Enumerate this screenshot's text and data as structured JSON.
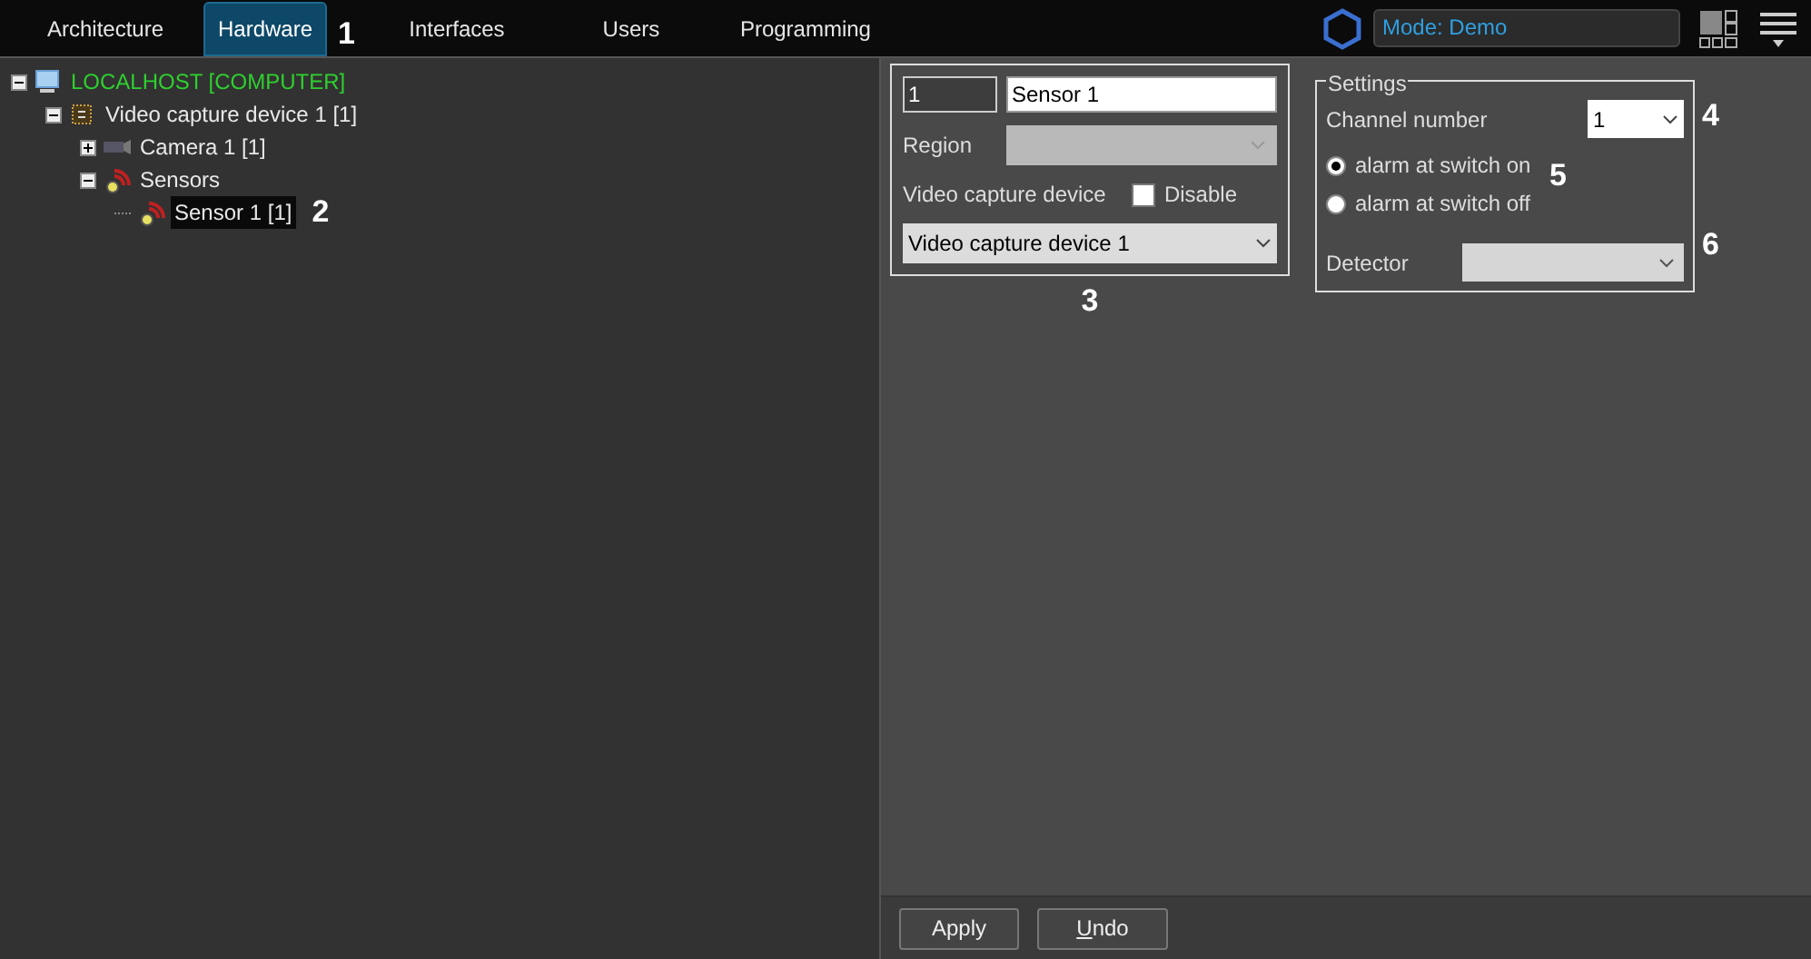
{
  "tabs": [
    {
      "label": "Architecture",
      "selected": false
    },
    {
      "label": "Hardware",
      "selected": true,
      "callout": "1"
    },
    {
      "label": "Interfaces",
      "selected": false
    },
    {
      "label": "Users",
      "selected": false
    },
    {
      "label": "Programming",
      "selected": false
    }
  ],
  "mode": {
    "value": "Mode: Demo"
  },
  "tree": [
    {
      "label": "LOCALHOST [COMPUTER]",
      "kind": "computer",
      "expanded": true,
      "selected": false,
      "children": [
        {
          "label": "Video capture device 1 [1]",
          "kind": "board",
          "expanded": true,
          "selected": false,
          "children": [
            {
              "label": "Camera 1 [1]",
              "kind": "camera",
              "expanded": false,
              "selected": false
            },
            {
              "label": "Sensors",
              "kind": "sensor",
              "expanded": true,
              "selected": false,
              "children": [
                {
                  "label": "Sensor 1 [1]",
                  "kind": "sensor",
                  "selected": true,
                  "callout": "2"
                }
              ]
            }
          ]
        }
      ]
    }
  ],
  "object": {
    "id": "1",
    "name": "Sensor 1",
    "region_label": "Region",
    "device_label": "Video capture device",
    "disable_label": "Disable",
    "disable_checked": false,
    "device_value": "Video capture device 1",
    "callout": "3"
  },
  "settings": {
    "title": "Settings",
    "channel_label": "Channel number",
    "channel_value": "1",
    "channel_callout": "4",
    "radios": [
      {
        "label": "alarm at switch on",
        "selected": true
      },
      {
        "label": "alarm at switch off",
        "selected": false
      }
    ],
    "radios_callout": "5",
    "detector_label": "Detector",
    "detector_callout": "6"
  },
  "buttons": [
    {
      "label": "Apply",
      "mnemonic": false
    },
    {
      "label": "Undo",
      "mnemonic": true
    }
  ]
}
